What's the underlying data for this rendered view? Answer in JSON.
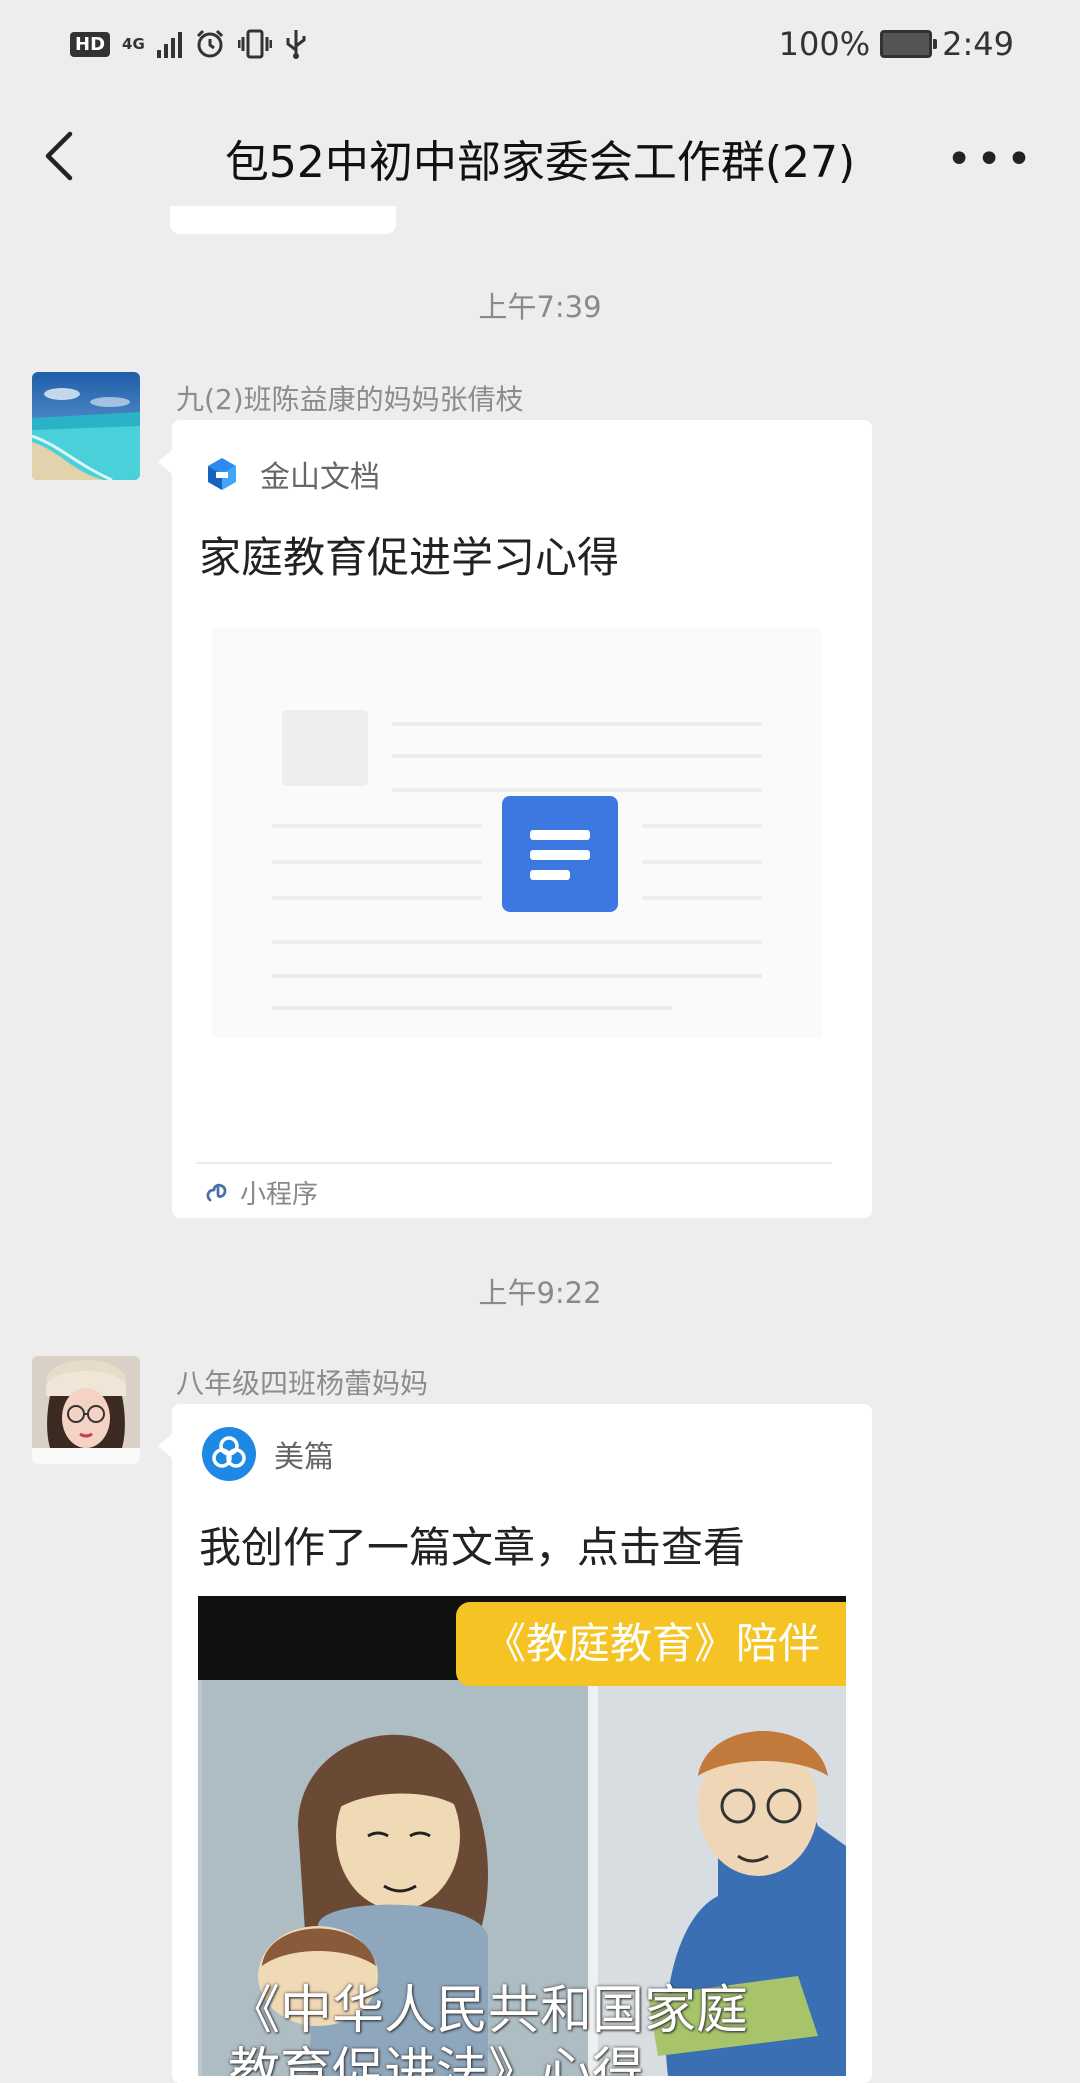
{
  "status_bar": {
    "hd": "HD",
    "network": "4G",
    "battery_percent": "100%",
    "time": "2:49"
  },
  "nav": {
    "title": "包52中初中部家委会工作群(27)",
    "more": "•••"
  },
  "messages": [
    {
      "timestamp": "上午7:39",
      "sender": "九(2)班陈益康的妈妈张倩枝",
      "app_name": "金山文档",
      "title": "家庭教育促进学习心得",
      "footer": "小程序"
    },
    {
      "timestamp": "上午9:22",
      "sender": "八年级四班杨蕾妈妈",
      "app_name": "美篇",
      "title": "我创作了一篇文章，点击查看",
      "image_badge": "《教庭教育》陪伴",
      "image_caption_line1": "《中华人民共和国家庭",
      "image_caption_line2": "教育促进法》心得"
    }
  ],
  "colors": {
    "background": "#ededed",
    "bubble": "#ffffff",
    "doc_icon": "#3b79e0",
    "meipian_icon": "#1e88e5",
    "badge": "#f5c324"
  }
}
